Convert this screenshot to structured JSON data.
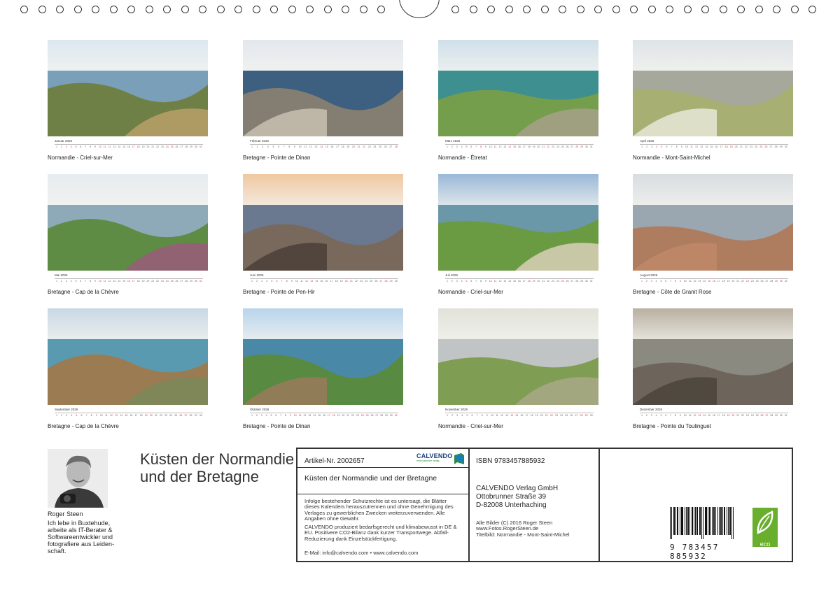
{
  "months": [
    {
      "name": "Januar 2026",
      "caption": "Normandie - Criel-sur-Mer",
      "days": 31,
      "weekends": [
        3,
        4,
        10,
        11,
        17,
        18,
        24,
        25,
        31
      ]
    },
    {
      "name": "Februar 2026",
      "caption": "Bretagne - Pointe de Dinan",
      "days": 28,
      "weekends": [
        1,
        7,
        8,
        14,
        15,
        21,
        22,
        28
      ]
    },
    {
      "name": "März 2026",
      "caption": "Normandie - Étretat",
      "days": 31,
      "weekends": [
        1,
        7,
        8,
        14,
        15,
        21,
        22,
        28,
        29
      ]
    },
    {
      "name": "April 2026",
      "caption": "Normandie - Mont-Saint-Michel",
      "days": 30,
      "weekends": [
        4,
        5,
        11,
        12,
        18,
        19,
        25,
        26
      ]
    },
    {
      "name": "Mai 2026",
      "caption": "Bretagne - Cap de la Chèvre",
      "days": 31,
      "weekends": [
        2,
        3,
        9,
        10,
        16,
        17,
        23,
        24,
        30,
        31
      ]
    },
    {
      "name": "Juni 2026",
      "caption": "Bretagne - Pointe de Pen-Hir",
      "days": 30,
      "weekends": [
        6,
        7,
        13,
        14,
        20,
        21,
        27,
        28
      ]
    },
    {
      "name": "Juli 2026",
      "caption": "Normandie - Criel-sur-Mer",
      "days": 31,
      "weekends": [
        4,
        5,
        11,
        12,
        18,
        19,
        25,
        26
      ]
    },
    {
      "name": "August 2026",
      "caption": "Bretagne - Côte de Granit Rose",
      "days": 31,
      "weekends": [
        1,
        2,
        8,
        9,
        15,
        16,
        22,
        23,
        29,
        30
      ]
    },
    {
      "name": "September 2026",
      "caption": "Bretagne - Cap de la Chèvre",
      "days": 30,
      "weekends": [
        5,
        6,
        12,
        13,
        19,
        20,
        26,
        27
      ]
    },
    {
      "name": "Oktober 2026",
      "caption": "Bretagne - Pointe de Dinan",
      "days": 31,
      "weekends": [
        3,
        4,
        10,
        11,
        17,
        18,
        24,
        25,
        31
      ]
    },
    {
      "name": "November 2026",
      "caption": "Normandie - Criel-sur-Mer",
      "days": 30,
      "weekends": [
        1,
        7,
        8,
        14,
        15,
        21,
        22,
        28,
        29
      ]
    },
    {
      "name": "Dezember 2026",
      "caption": "Bretagne - Pointe du Toulinguet",
      "days": 31,
      "weekends": [
        5,
        6,
        12,
        13,
        19,
        20,
        26,
        27
      ]
    }
  ],
  "author": {
    "name": "Roger Steen",
    "bio": "Ich lebe in Buxtehude, arbeite als IT-Berater & Softwareentwickler und fotografiere aus Leiden-schaft."
  },
  "title": "Küsten der Normandie und der Bretagne",
  "info": {
    "article": "Artikel-Nr. 2002657",
    "logo": "CALVENDO",
    "logo_sub": "mein kalender verlag",
    "subtitle": "Küsten der Normandie und der Bretagne",
    "legal1": "Infolge bestehender Schutzrechte ist es untersagt, die Blätter dieses Kalenders herauszutrennen und ohne Genehmigung des Verlages zu gewerblichen Zwecken weiterzuverwenden. Alle Angaben ohne Gewähr.",
    "legal2": "CALVENDO produziert bedarfsgerecht und klimabewusst in DE & EU. Positivere CO2-Bilanz dank kurzer Transportwege. Abfall-Reduzierung dank Einzelstückfertigung.",
    "contact": "E-Mail: info@calvendo.com • www.calvendo.com",
    "isbn": "ISBN 9783457885932",
    "publisher_name": "CALVENDO Verlag GmbH",
    "publisher_street": "Ottobrunner Straße 39",
    "publisher_city": "D-82008 Unterhaching",
    "credit1": "Alle Bilder (C) 2016 Roger Steen",
    "credit2": "www.Fotos.RogerSteen.de",
    "credit3": "Titelbild: Normandie - Mont-Saint-Michel",
    "barcode_digits": "9 783457 885932",
    "eco_label": "eco"
  },
  "colors": {
    "accent_red": "#dd3333",
    "calvendo_blue": "#1a3d7a",
    "eco_green": "#6aae2e"
  }
}
